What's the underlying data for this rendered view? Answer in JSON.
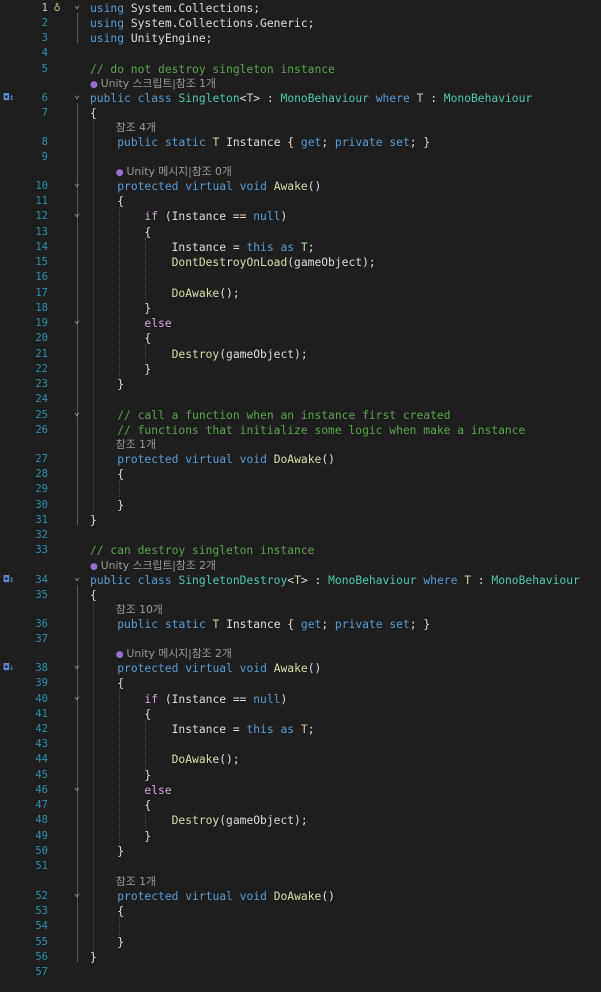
{
  "codelens": {
    "singleton_class": "Unity 스크립트|참조 1개",
    "instance_4": "참조 4개",
    "awake_0": "Unity 메시지|참조 0개",
    "doawake_1": "참조 1개",
    "singletondestroy_class": "Unity 스크립트|참조 2개",
    "instance_10": "참조 10개",
    "awake_2": "Unity 메시지|참조 2개",
    "doawake_1b": "참조 1개"
  },
  "lines": [
    {
      "n": "1",
      "t": [
        [
          "kw",
          "using"
        ],
        [
          "id",
          " System.Collections;"
        ]
      ]
    },
    {
      "n": "2",
      "t": [
        [
          "kw",
          "using"
        ],
        [
          "id",
          " System.Collections.Generic;"
        ]
      ]
    },
    {
      "n": "3",
      "t": [
        [
          "kw",
          "using"
        ],
        [
          "id",
          " UnityEngine;"
        ]
      ]
    },
    {
      "n": "4",
      "t": []
    },
    {
      "n": "5",
      "t": [
        [
          "cm",
          "// do not destroy singleton instance"
        ]
      ]
    },
    {
      "n": "6",
      "t": [
        [
          "kw",
          "public"
        ],
        [
          "id",
          " "
        ],
        [
          "kw",
          "class"
        ],
        [
          "id",
          " "
        ],
        [
          "ty",
          "Singleton"
        ],
        [
          "id",
          "<"
        ],
        [
          "tp",
          "T"
        ],
        [
          "id",
          "> : "
        ],
        [
          "ty",
          "MonoBehaviour"
        ],
        [
          "id",
          " "
        ],
        [
          "kw",
          "where"
        ],
        [
          "id",
          " "
        ],
        [
          "tp",
          "T"
        ],
        [
          "id",
          " : "
        ],
        [
          "ty",
          "MonoBehaviour"
        ]
      ]
    },
    {
      "n": "7",
      "t": [
        [
          "id",
          "{"
        ]
      ]
    },
    {
      "n": "8",
      "t": [
        [
          "id",
          "    "
        ],
        [
          "kw",
          "public"
        ],
        [
          "id",
          " "
        ],
        [
          "kw",
          "static"
        ],
        [
          "id",
          " "
        ],
        [
          "tp",
          "T"
        ],
        [
          "id",
          " Instance { "
        ],
        [
          "kw",
          "get"
        ],
        [
          "id",
          "; "
        ],
        [
          "kw",
          "private"
        ],
        [
          "id",
          " "
        ],
        [
          "kw",
          "set"
        ],
        [
          "id",
          "; }"
        ]
      ]
    },
    {
      "n": "9",
      "t": []
    },
    {
      "n": "10",
      "t": [
        [
          "id",
          "    "
        ],
        [
          "kw",
          "protected"
        ],
        [
          "id",
          " "
        ],
        [
          "kw",
          "virtual"
        ],
        [
          "id",
          " "
        ],
        [
          "kw",
          "void"
        ],
        [
          "id",
          " "
        ],
        [
          "fn",
          "Awake"
        ],
        [
          "id",
          "()"
        ]
      ]
    },
    {
      "n": "11",
      "t": [
        [
          "id",
          "    {"
        ]
      ]
    },
    {
      "n": "12",
      "t": [
        [
          "id",
          "        "
        ],
        [
          "ctl",
          "if"
        ],
        [
          "id",
          " (Instance == "
        ],
        [
          "kw",
          "null"
        ],
        [
          "id",
          ")"
        ]
      ]
    },
    {
      "n": "13",
      "t": [
        [
          "id",
          "        {"
        ]
      ]
    },
    {
      "n": "14",
      "t": [
        [
          "id",
          "            Instance = "
        ],
        [
          "kw",
          "this"
        ],
        [
          "id",
          " "
        ],
        [
          "kw",
          "as"
        ],
        [
          "id",
          " "
        ],
        [
          "tp",
          "T"
        ],
        [
          "id",
          ";"
        ]
      ]
    },
    {
      "n": "15",
      "t": [
        [
          "id",
          "            "
        ],
        [
          "fn",
          "DontDestroyOnLoad"
        ],
        [
          "id",
          "(gameObject);"
        ]
      ]
    },
    {
      "n": "16",
      "t": []
    },
    {
      "n": "17",
      "t": [
        [
          "id",
          "            "
        ],
        [
          "fn",
          "DoAwake"
        ],
        [
          "id",
          "();"
        ]
      ]
    },
    {
      "n": "18",
      "t": [
        [
          "id",
          "        }"
        ]
      ]
    },
    {
      "n": "19",
      "t": [
        [
          "id",
          "        "
        ],
        [
          "ctl",
          "else"
        ]
      ]
    },
    {
      "n": "20",
      "t": [
        [
          "id",
          "        {"
        ]
      ]
    },
    {
      "n": "21",
      "t": [
        [
          "id",
          "            "
        ],
        [
          "fn",
          "Destroy"
        ],
        [
          "id",
          "(gameObject);"
        ]
      ]
    },
    {
      "n": "22",
      "t": [
        [
          "id",
          "        }"
        ]
      ]
    },
    {
      "n": "23",
      "t": [
        [
          "id",
          "    }"
        ]
      ]
    },
    {
      "n": "24",
      "t": []
    },
    {
      "n": "25",
      "t": [
        [
          "id",
          "    "
        ],
        [
          "cm",
          "// call a function when an instance first created"
        ]
      ]
    },
    {
      "n": "26",
      "t": [
        [
          "id",
          "    "
        ],
        [
          "cm",
          "// functions that initialize some logic when make a instance"
        ]
      ]
    },
    {
      "n": "27",
      "t": [
        [
          "id",
          "    "
        ],
        [
          "kw",
          "protected"
        ],
        [
          "id",
          " "
        ],
        [
          "kw",
          "virtual"
        ],
        [
          "id",
          " "
        ],
        [
          "kw",
          "void"
        ],
        [
          "id",
          " "
        ],
        [
          "fn",
          "DoAwake"
        ],
        [
          "id",
          "()"
        ]
      ]
    },
    {
      "n": "28",
      "t": [
        [
          "id",
          "    {"
        ]
      ]
    },
    {
      "n": "29",
      "t": []
    },
    {
      "n": "30",
      "t": [
        [
          "id",
          "    }"
        ]
      ]
    },
    {
      "n": "31",
      "t": [
        [
          "id",
          "}"
        ]
      ]
    },
    {
      "n": "32",
      "t": []
    },
    {
      "n": "33",
      "t": [
        [
          "cm",
          "// can destroy singleton instance"
        ]
      ]
    },
    {
      "n": "34",
      "t": [
        [
          "kw",
          "public"
        ],
        [
          "id",
          " "
        ],
        [
          "kw",
          "class"
        ],
        [
          "id",
          " "
        ],
        [
          "ty",
          "SingletonDestroy"
        ],
        [
          "id",
          "<"
        ],
        [
          "tp",
          "T"
        ],
        [
          "id",
          "> : "
        ],
        [
          "ty",
          "MonoBehaviour"
        ],
        [
          "id",
          " "
        ],
        [
          "kw",
          "where"
        ],
        [
          "id",
          " "
        ],
        [
          "tp",
          "T"
        ],
        [
          "id",
          " : "
        ],
        [
          "ty",
          "MonoBehaviour"
        ]
      ]
    },
    {
      "n": "35",
      "t": [
        [
          "id",
          "{"
        ]
      ]
    },
    {
      "n": "36",
      "t": [
        [
          "id",
          "    "
        ],
        [
          "kw",
          "public"
        ],
        [
          "id",
          " "
        ],
        [
          "kw",
          "static"
        ],
        [
          "id",
          " "
        ],
        [
          "tp",
          "T"
        ],
        [
          "id",
          " Instance { "
        ],
        [
          "kw",
          "get"
        ],
        [
          "id",
          "; "
        ],
        [
          "kw",
          "private"
        ],
        [
          "id",
          " "
        ],
        [
          "kw",
          "set"
        ],
        [
          "id",
          "; }"
        ]
      ]
    },
    {
      "n": "37",
      "t": []
    },
    {
      "n": "38",
      "t": [
        [
          "id",
          "    "
        ],
        [
          "kw",
          "protected"
        ],
        [
          "id",
          " "
        ],
        [
          "kw",
          "virtual"
        ],
        [
          "id",
          " "
        ],
        [
          "kw",
          "void"
        ],
        [
          "id",
          " "
        ],
        [
          "fn",
          "Awake"
        ],
        [
          "id",
          "()"
        ]
      ]
    },
    {
      "n": "39",
      "t": [
        [
          "id",
          "    {"
        ]
      ]
    },
    {
      "n": "40",
      "t": [
        [
          "id",
          "        "
        ],
        [
          "ctl",
          "if"
        ],
        [
          "id",
          " (Instance == "
        ],
        [
          "kw",
          "null"
        ],
        [
          "id",
          ")"
        ]
      ]
    },
    {
      "n": "41",
      "t": [
        [
          "id",
          "        {"
        ]
      ]
    },
    {
      "n": "42",
      "t": [
        [
          "id",
          "            Instance = "
        ],
        [
          "kw",
          "this"
        ],
        [
          "id",
          " "
        ],
        [
          "kw",
          "as"
        ],
        [
          "id",
          " "
        ],
        [
          "tp",
          "T"
        ],
        [
          "id",
          ";"
        ]
      ]
    },
    {
      "n": "43",
      "t": []
    },
    {
      "n": "44",
      "t": [
        [
          "id",
          "            "
        ],
        [
          "fn",
          "DoAwake"
        ],
        [
          "id",
          "();"
        ]
      ]
    },
    {
      "n": "45",
      "t": [
        [
          "id",
          "        }"
        ]
      ]
    },
    {
      "n": "46",
      "t": [
        [
          "id",
          "        "
        ],
        [
          "ctl",
          "else"
        ]
      ]
    },
    {
      "n": "47",
      "t": [
        [
          "id",
          "        {"
        ]
      ]
    },
    {
      "n": "48",
      "t": [
        [
          "id",
          "            "
        ],
        [
          "fn",
          "Destroy"
        ],
        [
          "id",
          "(gameObject);"
        ]
      ]
    },
    {
      "n": "49",
      "t": [
        [
          "id",
          "        }"
        ]
      ]
    },
    {
      "n": "50",
      "t": [
        [
          "id",
          "    }"
        ]
      ]
    },
    {
      "n": "51",
      "t": []
    },
    {
      "n": "52",
      "t": [
        [
          "id",
          "    "
        ],
        [
          "kw",
          "protected"
        ],
        [
          "id",
          " "
        ],
        [
          "kw",
          "virtual"
        ],
        [
          "id",
          " "
        ],
        [
          "kw",
          "void"
        ],
        [
          "id",
          " "
        ],
        [
          "fn",
          "DoAwake"
        ],
        [
          "id",
          "()"
        ]
      ]
    },
    {
      "n": "53",
      "t": [
        [
          "id",
          "    {"
        ]
      ]
    },
    {
      "n": "54",
      "t": []
    },
    {
      "n": "55",
      "t": [
        [
          "id",
          "    }"
        ]
      ]
    },
    {
      "n": "56",
      "t": [
        [
          "id",
          "}"
        ]
      ]
    },
    {
      "n": "57",
      "t": []
    }
  ],
  "theme": {
    "background": "#1e1e1e",
    "keyword": "#569cd6",
    "control": "#d8a0df",
    "type": "#4ec9b0",
    "type_param": "#b8d7a3",
    "method": "#dcdcaa",
    "comment": "#57a64a",
    "line_number": "#2b91af"
  }
}
